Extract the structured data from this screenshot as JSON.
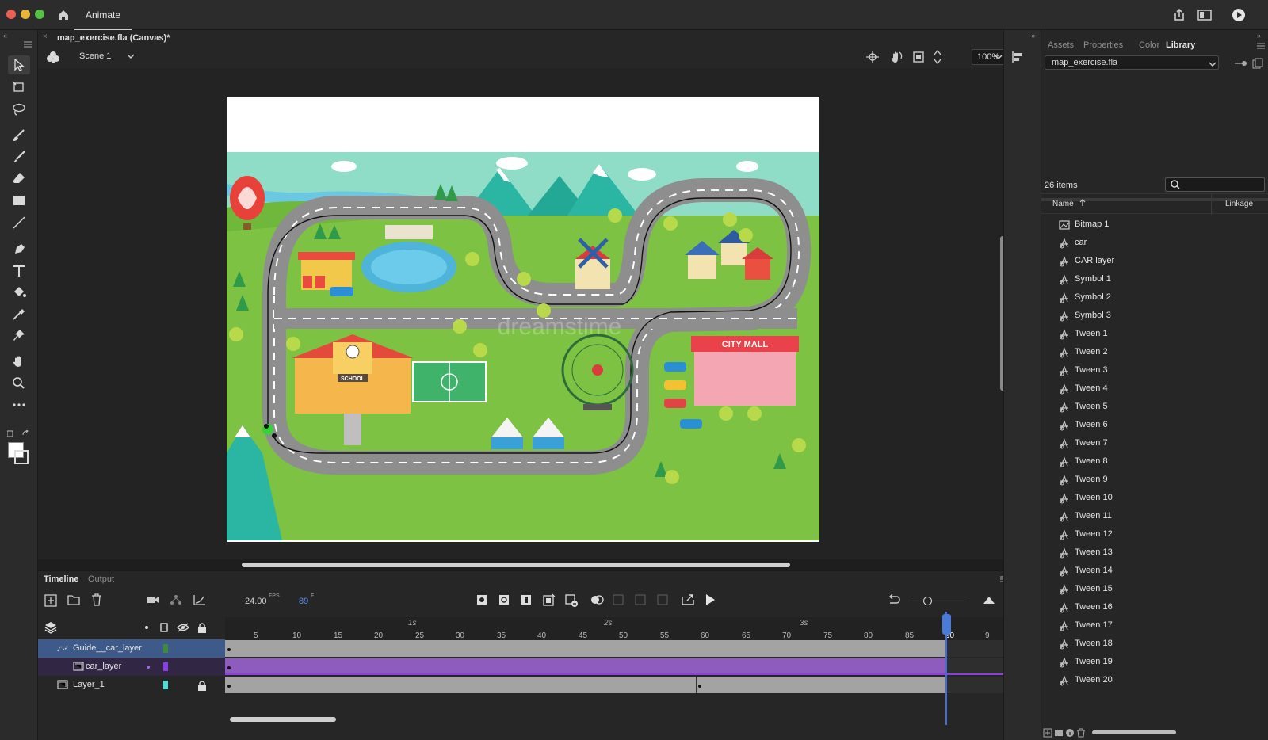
{
  "app": {
    "tab": "Animate"
  },
  "document": {
    "tab": "map_exercise.fla (Canvas)*"
  },
  "scene": {
    "name": "Scene 1",
    "zoom": "100%"
  },
  "stage": {
    "watermark": "dreamstime",
    "sign_school": "SCHOOL",
    "sign_mall": "CITY MALL"
  },
  "timeline": {
    "tabs": [
      "Timeline",
      "Output"
    ],
    "fps": "24.00",
    "fps_unit": "FPS",
    "frame": "89",
    "frame_unit": "F",
    "ruler": [
      "5",
      "10",
      "15",
      "20",
      "25",
      "30",
      "35",
      "40",
      "45",
      "50",
      "55",
      "60",
      "65",
      "70",
      "75",
      "80",
      "85",
      "90",
      "9"
    ],
    "seconds": [
      "1s",
      "2s",
      "3s"
    ],
    "layers": [
      {
        "name": "Guide__car_layer"
      },
      {
        "name": "car_layer"
      },
      {
        "name": "Layer_1"
      }
    ],
    "current_frame_fraction": 0.978
  },
  "right_panel": {
    "tabs": [
      "Assets",
      "Properties",
      "Color",
      "Library"
    ],
    "active_tab": "Library",
    "document": "map_exercise.fla",
    "count": "26 items",
    "col_name": "Name",
    "col_linkage": "Linkage",
    "items": [
      "Bitmap 1",
      "car",
      "CAR layer",
      "Symbol 1",
      "Symbol 2",
      "Symbol 3",
      "Tween 1",
      "Tween 2",
      "Tween 3",
      "Tween 4",
      "Tween 5",
      "Tween 6",
      "Tween 7",
      "Tween 8",
      "Tween 9",
      "Tween 10",
      "Tween 11",
      "Tween 12",
      "Tween 13",
      "Tween 14",
      "Tween 15",
      "Tween 16",
      "Tween 17",
      "Tween 18",
      "Tween 19",
      "Tween 20"
    ]
  },
  "colors": {
    "guide_layer": "#3d5a8a",
    "car_layer": "#7b4db0",
    "playhead": "#3d6fd6",
    "grass": "#79c142",
    "road": "#8e8e8e"
  }
}
